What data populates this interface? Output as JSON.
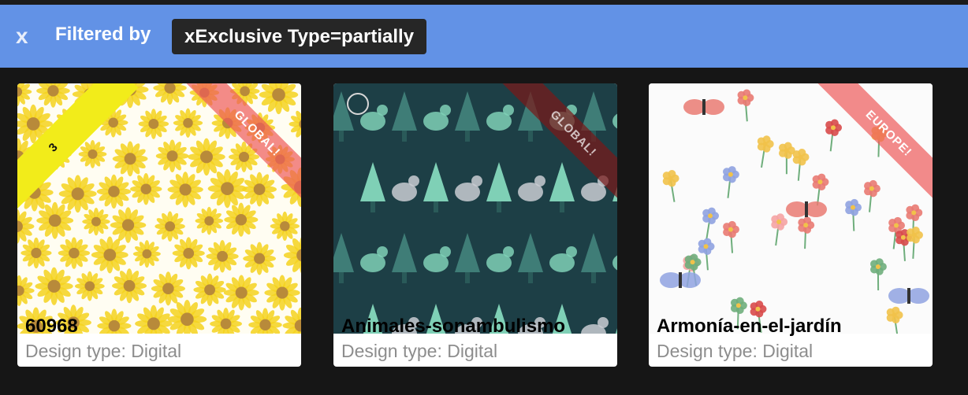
{
  "filter": {
    "clear_label": "x",
    "label": "Filtered by",
    "chip": "xExclusive Type=partially"
  },
  "cards": [
    {
      "title": "60968",
      "subtitle": "Design type: Digital",
      "ribbon": "GLOBAL!",
      "badge": "3",
      "pattern": "sunflowers",
      "colors": {
        "bg": "#fffdf2",
        "accent": "#f5d21f",
        "center": "#b88a3a"
      }
    },
    {
      "title": "Animales-sonambulismo",
      "subtitle": "Design type: Digital",
      "ribbon": "GLOBAL!",
      "pattern": "forest animals",
      "colors": {
        "bg": "#1d3f46",
        "accent": "#7fd0b6",
        "center": "#c9ccd2"
      }
    },
    {
      "title": "Armonía-en-el-jardín",
      "subtitle": "Design type: Digital",
      "ribbon": "EUROPE!",
      "pattern": "garden flowers and butterflies",
      "colors": {
        "bg": "#fbfbfb",
        "accent": "#e97a72",
        "center": "#8fa2e0"
      }
    }
  ]
}
